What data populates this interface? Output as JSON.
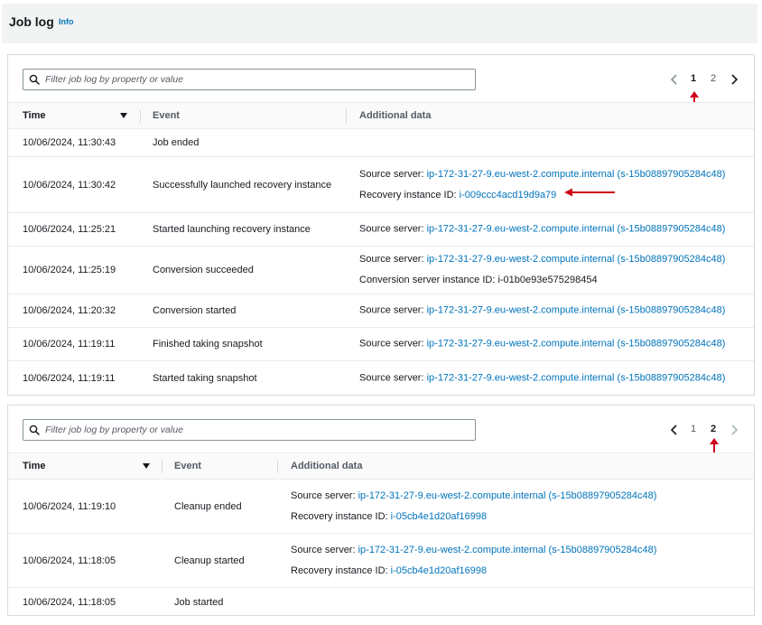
{
  "header": {
    "title": "Job log",
    "info_label": "Info"
  },
  "panel1": {
    "search": {
      "placeholder": "Filter job log by property or value",
      "value": ""
    },
    "pagination": {
      "pages": [
        "1",
        "2"
      ],
      "current": "1"
    },
    "columns": {
      "time": "Time",
      "event": "Event",
      "additional": "Additional data"
    },
    "rows": [
      {
        "time": "10/06/2024, 11:30:43",
        "event": "Job ended",
        "lines": []
      },
      {
        "time": "10/06/2024, 11:30:42",
        "event": "Successfully launched recovery instance",
        "lines": [
          {
            "label": "Source server: ",
            "value": "ip-172-31-27-9.eu-west-2.compute.internal (s-15b08897905284c48)",
            "link": true
          },
          {
            "label": "Recovery instance ID: ",
            "value": "i-009ccc4acd19d9a79",
            "link": true
          }
        ]
      },
      {
        "time": "10/06/2024, 11:25:21",
        "event": "Started launching recovery instance",
        "lines": [
          {
            "label": "Source server: ",
            "value": "ip-172-31-27-9.eu-west-2.compute.internal (s-15b08897905284c48)",
            "link": true
          }
        ]
      },
      {
        "time": "10/06/2024, 11:25:19",
        "event": "Conversion succeeded",
        "lines": [
          {
            "label": "Source server: ",
            "value": "ip-172-31-27-9.eu-west-2.compute.internal (s-15b08897905284c48)",
            "link": true
          },
          {
            "label": "Conversion server instance ID: ",
            "value": "i-01b0e93e575298454",
            "link": false
          }
        ]
      },
      {
        "time": "10/06/2024, 11:20:32",
        "event": "Conversion started",
        "lines": [
          {
            "label": "Source server: ",
            "value": "ip-172-31-27-9.eu-west-2.compute.internal (s-15b08897905284c48)",
            "link": true
          }
        ]
      },
      {
        "time": "10/06/2024, 11:19:11",
        "event": "Finished taking snapshot",
        "lines": [
          {
            "label": "Source server: ",
            "value": "ip-172-31-27-9.eu-west-2.compute.internal (s-15b08897905284c48)",
            "link": true
          }
        ]
      },
      {
        "time": "10/06/2024, 11:19:11",
        "event": "Started taking snapshot",
        "lines": [
          {
            "label": "Source server: ",
            "value": "ip-172-31-27-9.eu-west-2.compute.internal (s-15b08897905284c48)",
            "link": true
          }
        ]
      }
    ]
  },
  "panel2": {
    "search": {
      "placeholder": "Filter job log by property or value",
      "value": ""
    },
    "pagination": {
      "pages": [
        "1",
        "2"
      ],
      "current": "2"
    },
    "columns": {
      "time": "Time",
      "event": "Event",
      "additional": "Additional data"
    },
    "rows": [
      {
        "time": "10/06/2024, 11:19:10",
        "event": "Cleanup ended",
        "lines": [
          {
            "label": "Source server: ",
            "value": "ip-172-31-27-9.eu-west-2.compute.internal (s-15b08897905284c48)",
            "link": true
          },
          {
            "label": "Recovery instance ID: ",
            "value": "i-05cb4e1d20af16998",
            "link": true
          }
        ]
      },
      {
        "time": "10/06/2024, 11:18:05",
        "event": "Cleanup started",
        "lines": [
          {
            "label": "Source server: ",
            "value": "ip-172-31-27-9.eu-west-2.compute.internal (s-15b08897905284c48)",
            "link": true
          },
          {
            "label": "Recovery instance ID: ",
            "value": "i-05cb4e1d20af16998",
            "link": true
          }
        ]
      },
      {
        "time": "10/06/2024, 11:18:05",
        "event": "Job started",
        "lines": []
      }
    ]
  },
  "colors": {
    "link": "#0073bb",
    "annotation_arrow": "#d0021b",
    "header_bg": "#f2f3f3",
    "border": "#d5dbdb"
  }
}
